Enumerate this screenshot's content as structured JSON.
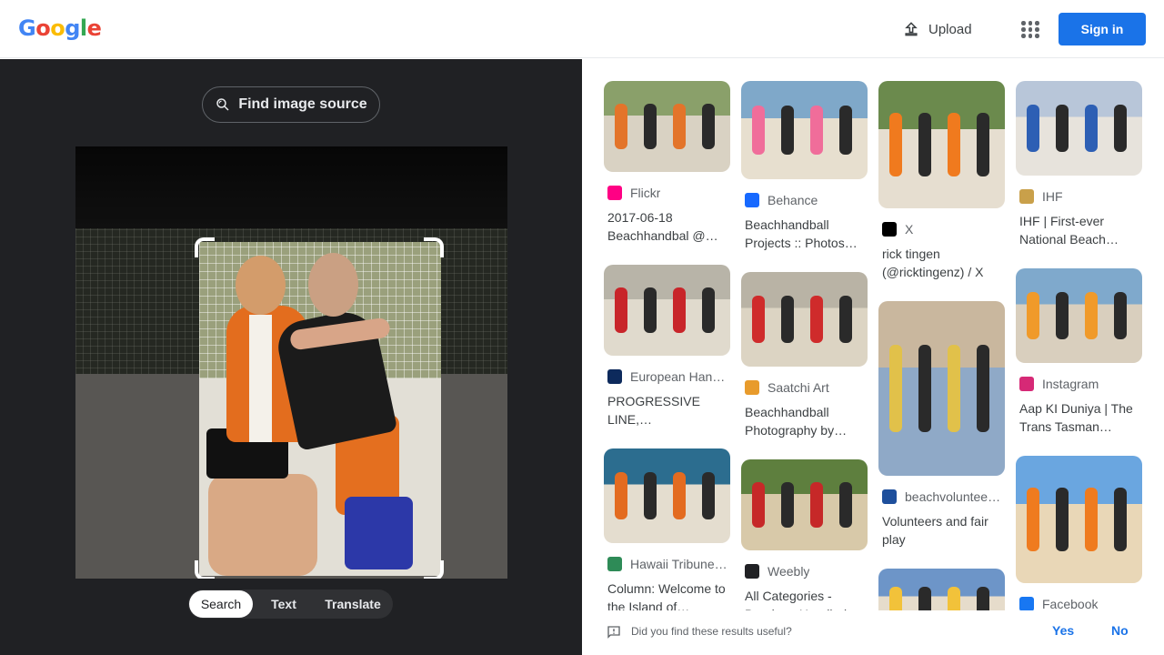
{
  "header": {
    "logo_letters": [
      {
        "ch": "G",
        "color": "#4285F4"
      },
      {
        "ch": "o",
        "color": "#EA4335"
      },
      {
        "ch": "o",
        "color": "#FBBC05"
      },
      {
        "ch": "g",
        "color": "#4285F4"
      },
      {
        "ch": "l",
        "color": "#34A853"
      },
      {
        "ch": "e",
        "color": "#EA4335"
      }
    ],
    "upload_label": "Upload",
    "apps_icon": "apps-grid-icon",
    "sign_in_label": "Sign in"
  },
  "lens": {
    "find_source_label": "Find image source",
    "modes": [
      "Search",
      "Text",
      "Translate"
    ],
    "active_mode": "Search"
  },
  "results": {
    "columns": [
      [
        {
          "source": "Flickr",
          "title": "2017-06-18 Beachhandbal @…",
          "thumb_colors": [
            "#8aa06a",
            "#d9d2c3",
            "#e3742a"
          ],
          "fav_icon": "flickr-icon",
          "fav_color": "#ff0084"
        },
        {
          "source": "European Han…",
          "title": "PROGRESSIVE LINE,…",
          "thumb_colors": [
            "#b8b4a8",
            "#e0dacd",
            "#c8252a"
          ],
          "fav_icon": "ehf-icon",
          "fav_color": "#0d2a5c"
        },
        {
          "source": "Hawaii Tribune…",
          "title": "Column: Welcome to the Island of…",
          "thumb_colors": [
            "#2c6d8f",
            "#e4ddcf",
            "#e36b20"
          ],
          "fav_icon": "hawaii-tribune-icon",
          "fav_color": "#2e8b57"
        }
      ],
      [
        {
          "source": "Behance",
          "title": "Beachhandball Projects :: Photos…",
          "thumb_colors": [
            "#7fa8c9",
            "#e7dfcf",
            "#f06d9a"
          ],
          "fav_icon": "behance-icon",
          "fav_color": "#1769ff"
        },
        {
          "source": "Saatchi Art",
          "title": "Beachhandball Photography by…",
          "thumb_colors": [
            "#b9b3a5",
            "#dcd4c3",
            "#cf2b2b"
          ],
          "fav_icon": "saatchi-art-icon",
          "fav_color": "#e89b2c"
        },
        {
          "source": "Weebly",
          "title": "All Categories - Breakers Handbal…",
          "thumb_colors": [
            "#5e7f3e",
            "#d8c9a9",
            "#c62828"
          ],
          "fav_icon": "weebly-icon",
          "fav_color": "#202124"
        }
      ],
      [
        {
          "source": "X",
          "title": "rick tingen (@ricktingenz) / X",
          "thumb_colors": [
            "#6b8a4d",
            "#e6ded0",
            "#f07a1e"
          ],
          "fav_icon": "x-icon",
          "fav_color": "#000000"
        },
        {
          "source": "beachvolunteer…",
          "title": "Volunteers and fair play",
          "thumb_colors": [
            "#c9b79e",
            "#8fa9c7",
            "#e1c14a"
          ],
          "fav_icon": "beachvolunteers-icon",
          "fav_color": "#1e4f9c"
        },
        {
          "source": "",
          "title": "",
          "thumb_colors": [
            "#6d95c8",
            "#e6dccb",
            "#f2c23a"
          ],
          "fav_icon": "",
          "fav_color": "#ffffff"
        }
      ],
      [
        {
          "source": "IHF",
          "title": "IHF | First-ever National Beach…",
          "thumb_colors": [
            "#b8c6d9",
            "#e7e3dc",
            "#2d5fb4"
          ],
          "fav_icon": "ihf-icon",
          "fav_color": "#c9a04a"
        },
        {
          "source": "Instagram",
          "title": "Aap KI Duniya | The Trans Tasman…",
          "thumb_colors": [
            "#7fa9cc",
            "#d9cfbe",
            "#f09a2a"
          ],
          "fav_icon": "instagram-icon",
          "fav_color": "#d62976"
        },
        {
          "source": "Facebook",
          "title": "",
          "thumb_colors": [
            "#6aa6e0",
            "#e9d7b7",
            "#ef7b1f"
          ],
          "fav_icon": "facebook-icon",
          "fav_color": "#1877f2"
        }
      ]
    ]
  },
  "feedback": {
    "question": "Did you find these results useful?",
    "yes_label": "Yes",
    "no_label": "No"
  }
}
